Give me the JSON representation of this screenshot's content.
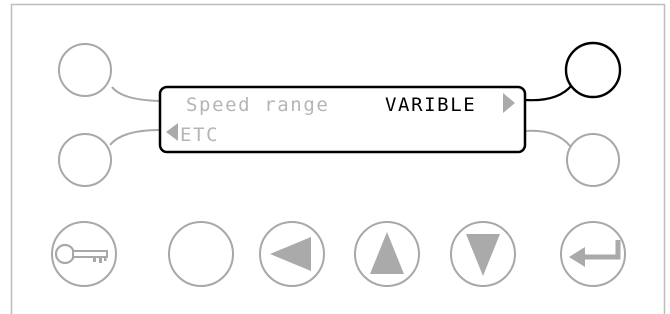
{
  "display": {
    "line1_label": "Speed range",
    "line1_value": "VARIBLE",
    "line2_label": "ETC"
  },
  "buttons": {
    "softkey_top_left": {
      "icon": "blank-round-button"
    },
    "softkey_top_right": {
      "icon": "blank-round-button",
      "active": true
    },
    "softkey_bottom_left": {
      "icon": "blank-round-button"
    },
    "softkey_bottom_right": {
      "icon": "blank-round-button"
    },
    "key": {
      "icon": "key-icon"
    },
    "blank": {
      "icon": "blank-round-button"
    },
    "left": {
      "icon": "arrow-left-icon"
    },
    "up": {
      "icon": "arrow-up-icon"
    },
    "down": {
      "icon": "arrow-down-icon"
    },
    "enter": {
      "icon": "enter-icon"
    }
  },
  "colors": {
    "frame": "#bdbdbd",
    "inactive_stroke": "#a8a8a8",
    "active_stroke": "#000000",
    "dim_text": "#b5b5b5",
    "active_text": "#000000",
    "arrow_fill": "#aaaaaa"
  }
}
